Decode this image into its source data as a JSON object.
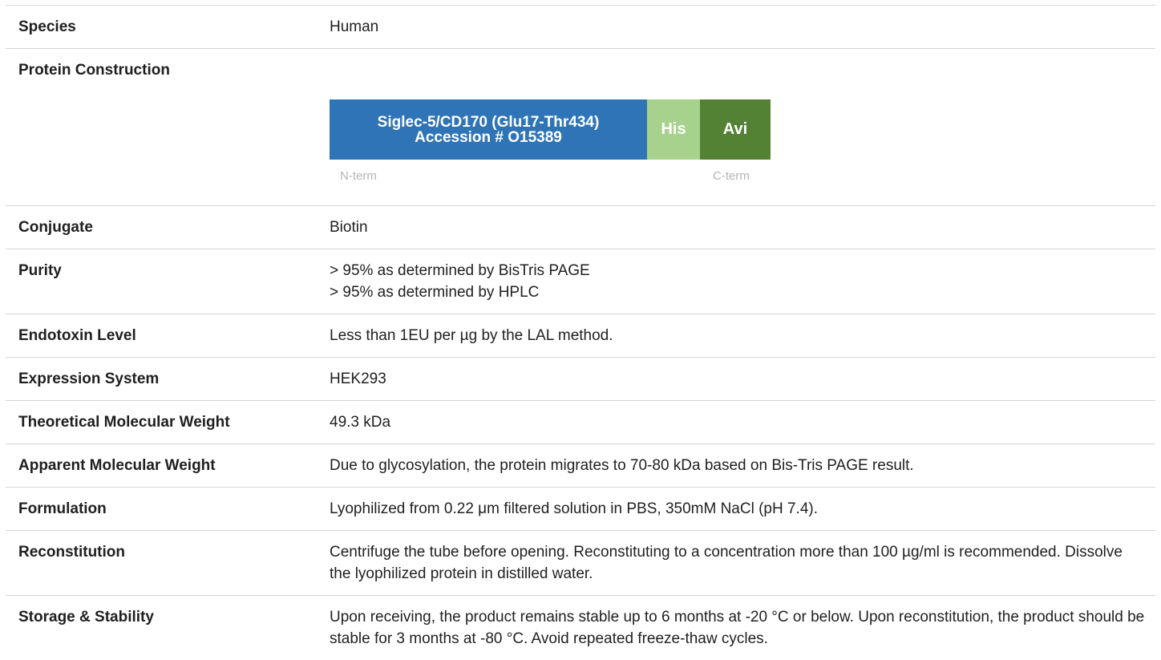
{
  "rows": [
    {
      "label": "Species",
      "value": [
        "Human"
      ]
    },
    {
      "label": "Protein Construction"
    },
    {
      "label": "Conjugate",
      "value": [
        "Biotin"
      ]
    },
    {
      "label": "Purity",
      "value": [
        "> 95% as determined by BisTris PAGE",
        "> 95% as determined by HPLC"
      ]
    },
    {
      "label": "Endotoxin Level",
      "value": [
        "Less than 1EU per µg by the LAL method."
      ]
    },
    {
      "label": "Expression System",
      "value": [
        "HEK293"
      ]
    },
    {
      "label": "Theoretical Molecular Weight",
      "value": [
        "49.3 kDa"
      ]
    },
    {
      "label": "Apparent Molecular Weight",
      "value": [
        "Due to glycosylation, the protein migrates to 70-80 kDa based on Bis-Tris PAGE result."
      ]
    },
    {
      "label": "Formulation",
      "value": [
        "Lyophilized from 0.22 μm filtered solution in PBS, 350mM NaCl (pH 7.4)."
      ]
    },
    {
      "label": "Reconstitution",
      "value": [
        "Centrifuge the tube before opening. Reconstituting to a concentration more than 100 µg/ml is recommended. Dissolve the lyophilized protein in distilled water."
      ]
    },
    {
      "label": "Storage & Stability",
      "value": [
        "Upon receiving, the product remains stable up to 6 months at -20 °C or below. Upon reconstitution, the product should be stable for 3 months at -80 °C. Avoid repeated freeze-thaw cycles."
      ]
    }
  ],
  "construct": {
    "main_line1": "Siglec-5/CD170 (Glu17-Thr434)",
    "main_line2": "Accession # O15389",
    "his": "His",
    "avi": "Avi",
    "n_term": "N-term",
    "c_term": "C-term",
    "colors": {
      "main": "#2f74b6",
      "his": "#a7d28d",
      "avi": "#548235"
    }
  }
}
